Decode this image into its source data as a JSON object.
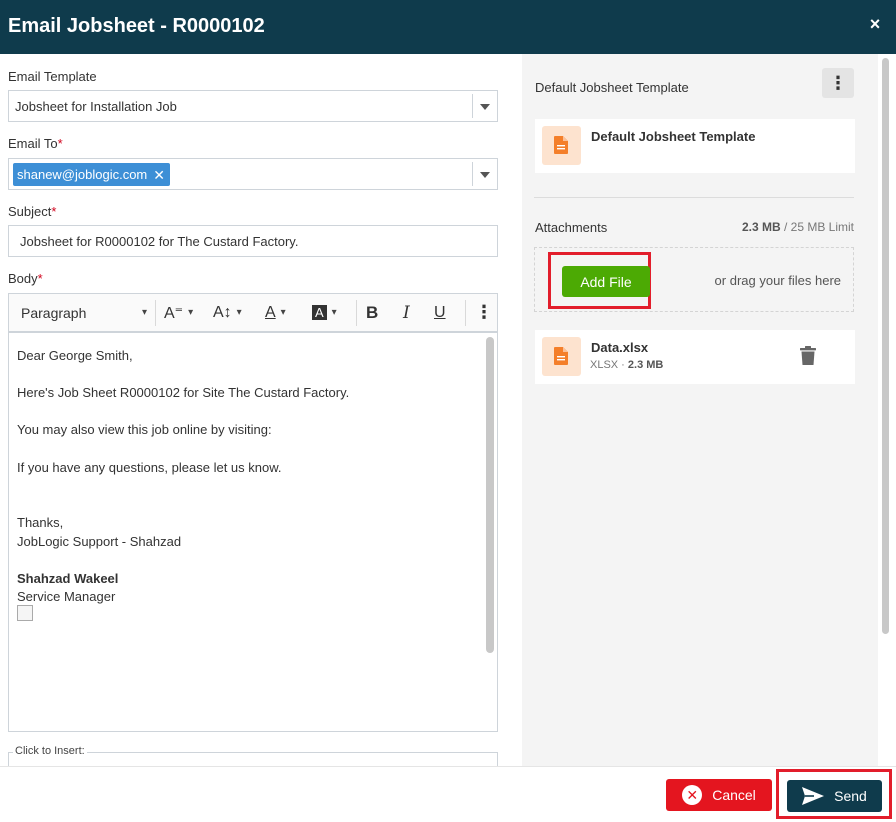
{
  "header": {
    "title": "Email Jobsheet - R0000102",
    "close_icon": "×"
  },
  "form": {
    "template_label": "Email Template",
    "template_value": "Jobsheet for Installation Job",
    "to_label": "Email To",
    "to_chip": "shanew@joblogic.com",
    "chip_remove": "✕",
    "subject_label": "Subject",
    "subject_value": "Jobsheet for R0000102 for The Custard Factory.",
    "body_label": "Body",
    "required_mark": "*"
  },
  "toolbar": {
    "paragraph": "Paragraph",
    "font_family_icon": "A⁼",
    "font_size_icon": "A↕",
    "font_color_icon": "A",
    "bg_color_icon": "A",
    "bold": "B",
    "italic": "I",
    "underline": "U",
    "more": "⋮",
    "chevron": "▾"
  },
  "body": {
    "lines": [
      "Dear George Smith,",
      "Here's Job Sheet R0000102 for Site The Custard Factory.",
      "You may also view this job online by visiting:",
      "If you have any questions, please let us know.",
      "Thanks,",
      "JobLogic Support - Shahzad",
      "Shahzad Wakeel",
      "Service Manager"
    ]
  },
  "insert": {
    "legend": "Click to Insert:"
  },
  "right": {
    "template_title": "Default Jobsheet Template",
    "kebab": "⋮",
    "template_card_name": "Default Jobsheet Template",
    "attachments_label": "Attachments",
    "limit_used": "2.3 MB",
    "limit_total": " / 25 MB Limit",
    "add_file": "Add File",
    "drag_hint": "or drag your files here",
    "file": {
      "name": "Data.xlsx",
      "type": "XLSX · ",
      "size": "2.3 MB"
    }
  },
  "footer": {
    "cancel": "Cancel",
    "cancel_icon": "✕",
    "send": "Send"
  },
  "colors": {
    "header_bg": "#0f3b4c",
    "add_file_green": "#4caa04",
    "cancel_red": "#e4151f",
    "highlight_red": "#e21d2b",
    "chip_blue": "#3d8fd6",
    "file_icon_orange": "#f47f2a"
  },
  "icons": {
    "file": "document-icon",
    "trash": "trash-icon",
    "send": "paper-plane-icon",
    "cancel": "cancel-circle-icon"
  }
}
